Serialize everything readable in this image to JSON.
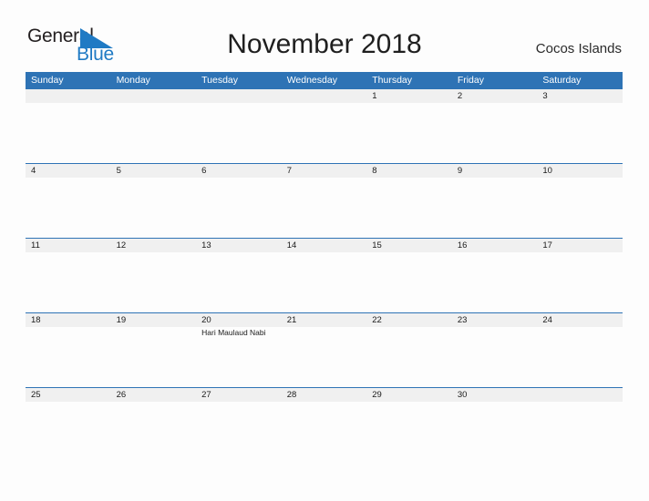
{
  "brand": {
    "name_part1": "General",
    "name_part2": "Blue",
    "accent_color": "#1f7ac4",
    "flag_icon": "blue-flag-triangle-icon"
  },
  "header": {
    "title": "November 2018",
    "region": "Cocos Islands"
  },
  "theme": {
    "header_blue": "#2e73b5",
    "date_band_gray": "#f0f0f0",
    "page_background": "#fdfdfd",
    "text_color": "#1a1a1a"
  },
  "calendar": {
    "month": "November",
    "year": "2018",
    "weekday_headers": [
      "Sunday",
      "Monday",
      "Tuesday",
      "Wednesday",
      "Thursday",
      "Friday",
      "Saturday"
    ],
    "weeks": [
      {
        "days": [
          {
            "date": "",
            "event": ""
          },
          {
            "date": "",
            "event": ""
          },
          {
            "date": "",
            "event": ""
          },
          {
            "date": "",
            "event": ""
          },
          {
            "date": "1",
            "event": ""
          },
          {
            "date": "2",
            "event": ""
          },
          {
            "date": "3",
            "event": ""
          }
        ]
      },
      {
        "days": [
          {
            "date": "4",
            "event": ""
          },
          {
            "date": "5",
            "event": ""
          },
          {
            "date": "6",
            "event": ""
          },
          {
            "date": "7",
            "event": ""
          },
          {
            "date": "8",
            "event": ""
          },
          {
            "date": "9",
            "event": ""
          },
          {
            "date": "10",
            "event": ""
          }
        ]
      },
      {
        "days": [
          {
            "date": "11",
            "event": ""
          },
          {
            "date": "12",
            "event": ""
          },
          {
            "date": "13",
            "event": ""
          },
          {
            "date": "14",
            "event": ""
          },
          {
            "date": "15",
            "event": ""
          },
          {
            "date": "16",
            "event": ""
          },
          {
            "date": "17",
            "event": ""
          }
        ]
      },
      {
        "days": [
          {
            "date": "18",
            "event": ""
          },
          {
            "date": "19",
            "event": ""
          },
          {
            "date": "20",
            "event": "Hari Maulaud Nabi"
          },
          {
            "date": "21",
            "event": ""
          },
          {
            "date": "22",
            "event": ""
          },
          {
            "date": "23",
            "event": ""
          },
          {
            "date": "24",
            "event": ""
          }
        ]
      },
      {
        "days": [
          {
            "date": "25",
            "event": ""
          },
          {
            "date": "26",
            "event": ""
          },
          {
            "date": "27",
            "event": ""
          },
          {
            "date": "28",
            "event": ""
          },
          {
            "date": "29",
            "event": ""
          },
          {
            "date": "30",
            "event": ""
          },
          {
            "date": "",
            "event": ""
          }
        ]
      }
    ]
  }
}
